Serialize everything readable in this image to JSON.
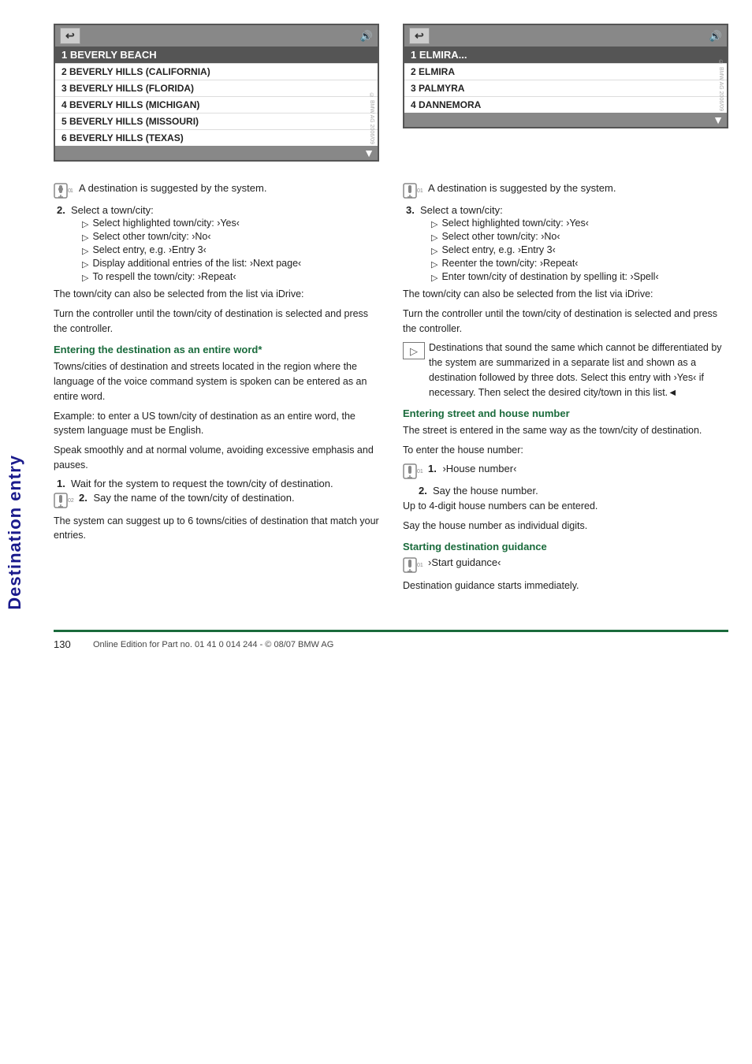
{
  "sidebar": {
    "title": "Destination entry"
  },
  "left_nav": {
    "back_icon": "⬅",
    "voice_icon": "🔊",
    "items": [
      "1 BEVERLY BEACH",
      "2 BEVERLY HILLS (CALIFORNIA)",
      "3 BEVERLY HILLS (FLORIDA)",
      "4 BEVERLY HILLS (MICHIGAN)",
      "5 BEVERLY HILLS (MISSOURI)",
      "6 BEVERLY HILLS (TEXAS)"
    ]
  },
  "right_nav": {
    "back_icon": "⬅",
    "voice_icon": "🔊",
    "items": [
      "1 ELMIRA...",
      "2 ELMIRA",
      "3 PALMYRA",
      "4 DANNEMORA"
    ]
  },
  "left_column": {
    "mic_intro": "A destination is suggested by the system.",
    "step2_label": "2.",
    "step2_text": "Select a town/city:",
    "sub_items": [
      "Select highlighted town/city: ›Yes‹",
      "Select other town/city: ›No‹",
      "Select entry, e.g. ›Entry 3‹",
      "Display additional entries of the list: ›Next page‹",
      "To respell the town/city: ›Repeat‹"
    ],
    "para1": "The town/city can also be selected from the list via iDrive:",
    "para2": "Turn the controller until the town/city of destination is selected and press the controller.",
    "section1_title": "Entering the destination as an entire word*",
    "section1_para1": "Towns/cities of destination and streets located in the region where the language of the voice command system is spoken can be entered as an entire word.",
    "section1_para2": "Example: to enter a US town/city of destination as an entire word, the system language must be English.",
    "section1_para3": "Speak smoothly and at normal volume, avoiding excessive emphasis and pauses.",
    "step1_text": "Wait for the system to request the town/city of destination.",
    "mic_step2_text": "Say the name of the town/city of destination.",
    "system_suggest": "The system can suggest up to 6 towns/cities of destination that match your entries."
  },
  "right_column": {
    "mic_intro": "A destination is suggested by the system.",
    "step3_label": "3.",
    "step3_text": "Select a town/city:",
    "sub_items": [
      "Select highlighted town/city: ›Yes‹",
      "Select other town/city: ›No‹",
      "Select entry, e.g. ›Entry 3‹",
      "Reenter the town/city: ›Repeat‹",
      "Enter town/city of destination by spelling it: ›Spell‹"
    ],
    "para1": "The town/city can also be selected from the list via iDrive:",
    "para2": "Turn the controller until the town/city of destination is selected and press the controller.",
    "note_text": "Destinations that sound the same which cannot be differentiated by the system are summarized in a separate list and shown as a destination followed by three dots. Select this entry with ›Yes‹ if necessary. Then select the desired city/town in this list.◄",
    "section2_title": "Entering street and house number",
    "section2_para1": "The street is entered in the same way as the town/city of destination.",
    "section2_para2": "To enter the house number:",
    "house_step1": "›House number‹",
    "house_step2": "Say the house number.",
    "house_note1": "Up to 4-digit house numbers can be entered.",
    "house_note2": "Say the house number as individual digits.",
    "section3_title": "Starting destination guidance",
    "guidance_cmd": "›Start guidance‹",
    "guidance_note": "Destination guidance starts immediately."
  },
  "footer": {
    "page_number": "130",
    "text": "Online Edition for Part no. 01 41 0 014 244 - © 08/07 BMW AG"
  }
}
